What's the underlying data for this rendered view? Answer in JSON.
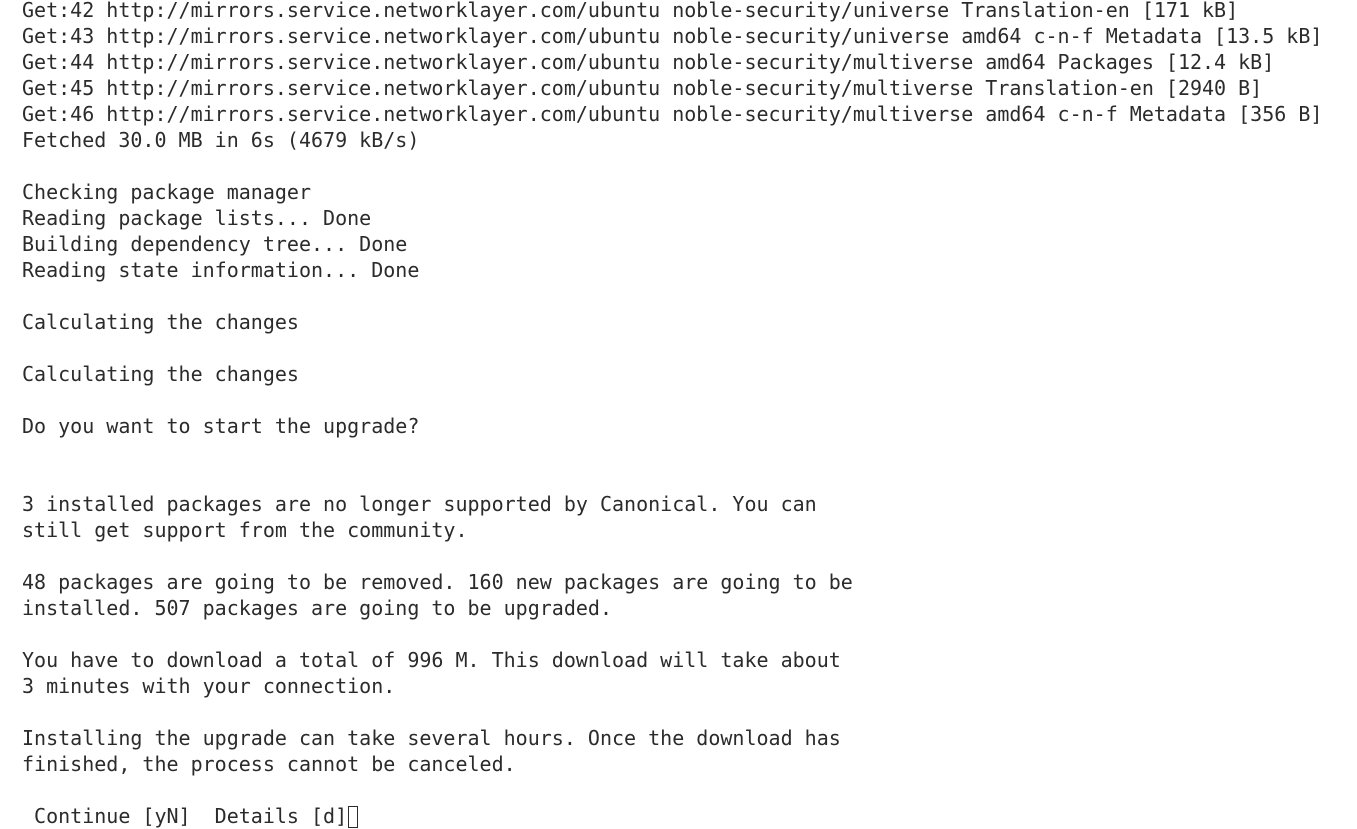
{
  "terminal": {
    "lines": [
      "Get:42 http://mirrors.service.networklayer.com/ubuntu noble-security/universe Translation-en [171 kB]",
      "Get:43 http://mirrors.service.networklayer.com/ubuntu noble-security/universe amd64 c-n-f Metadata [13.5 kB]",
      "Get:44 http://mirrors.service.networklayer.com/ubuntu noble-security/multiverse amd64 Packages [12.4 kB]",
      "Get:45 http://mirrors.service.networklayer.com/ubuntu noble-security/multiverse Translation-en [2940 B]",
      "Get:46 http://mirrors.service.networklayer.com/ubuntu noble-security/multiverse amd64 c-n-f Metadata [356 B]",
      "Fetched 30.0 MB in 6s (4679 kB/s)",
      "",
      "Checking package manager",
      "Reading package lists... Done",
      "Building dependency tree... Done",
      "Reading state information... Done",
      "",
      "Calculating the changes",
      "",
      "Calculating the changes",
      "",
      "Do you want to start the upgrade?",
      "",
      "",
      "3 installed packages are no longer supported by Canonical. You can",
      "still get support from the community.",
      "",
      "48 packages are going to be removed. 160 new packages are going to be",
      "installed. 507 packages are going to be upgraded.",
      "",
      "You have to download a total of 996 M. This download will take about",
      "3 minutes with your connection.",
      "",
      "Installing the upgrade can take several hours. Once the download has",
      "finished, the process cannot be canceled.",
      ""
    ],
    "prompt": " Continue [yN]  Details [d]"
  }
}
